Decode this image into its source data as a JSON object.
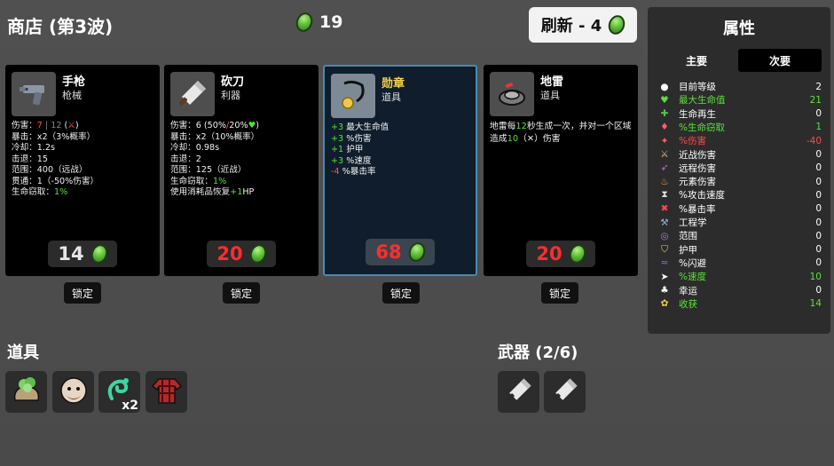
{
  "header": {
    "title": "商店 (第3波)",
    "materials": "19",
    "reroll_label": "刷新 - 4"
  },
  "shop": {
    "items": [
      {
        "name": "手枪",
        "category": "枪械",
        "price": "14",
        "price_color": "#e6e6e6",
        "lock_label": "锁定",
        "icon": "pistol-icon",
        "stats": [
          {
            "segments": [
              {
                "t": "伤害：",
                "c": ""
              },
              {
                "t": "7",
                "c": "r"
              },
              {
                "t": " | 12",
                "c": "gr"
              },
              {
                "t": " (",
                "c": ""
              },
              {
                "t": "⚔",
                "c": "r"
              },
              {
                "t": ")",
                "c": ""
              }
            ]
          },
          {
            "segments": [
              {
                "t": "暴击：x2（3%概率）",
                "c": ""
              }
            ]
          },
          {
            "segments": [
              {
                "t": "冷却：1.2s",
                "c": ""
              }
            ]
          },
          {
            "segments": [
              {
                "t": "击退：15",
                "c": ""
              }
            ]
          },
          {
            "segments": [
              {
                "t": "范围：400（远战）",
                "c": ""
              }
            ]
          },
          {
            "segments": [
              {
                "t": "贯通：1（-50%伤害）",
                "c": ""
              }
            ]
          },
          {
            "segments": [
              {
                "t": "生命窃取：",
                "c": ""
              },
              {
                "t": "1%",
                "c": "g"
              }
            ]
          }
        ]
      },
      {
        "name": "砍刀",
        "category": "利器",
        "price": "20",
        "price_color": "#ff2e2e",
        "lock_label": "锁定",
        "icon": "cleaver-icon",
        "stats": [
          {
            "segments": [
              {
                "t": "伤害：6 (50%",
                "c": ""
              },
              {
                "t": "/",
                "c": "r"
              },
              {
                "t": "20%",
                "c": ""
              },
              {
                "t": "♥",
                "c": "g"
              },
              {
                "t": ")",
                "c": ""
              }
            ]
          },
          {
            "segments": [
              {
                "t": "暴击：x2（10%概率）",
                "c": ""
              }
            ]
          },
          {
            "segments": [
              {
                "t": "冷却：0.98s",
                "c": ""
              }
            ]
          },
          {
            "segments": [
              {
                "t": "击退：2",
                "c": ""
              }
            ]
          },
          {
            "segments": [
              {
                "t": "范围：125（近战）",
                "c": ""
              }
            ]
          },
          {
            "segments": [
              {
                "t": "生命窃取：",
                "c": ""
              },
              {
                "t": "1%",
                "c": "g"
              }
            ]
          },
          {
            "segments": [
              {
                "t": "使用消耗品恢复",
                "c": ""
              },
              {
                "t": "+1",
                "c": "g"
              },
              {
                "t": "HP",
                "c": ""
              }
            ]
          }
        ]
      },
      {
        "name": "勋章",
        "category": "道具",
        "price": "68",
        "price_color": "#ff2e2e",
        "lock_label": "锁定",
        "icon": "medal-icon",
        "stats": [
          {
            "segments": [
              {
                "t": "+3",
                "c": "g"
              },
              {
                "t": " 最大生命值",
                "c": ""
              }
            ]
          },
          {
            "segments": [
              {
                "t": "+3",
                "c": "g"
              },
              {
                "t": " %伤害",
                "c": ""
              }
            ]
          },
          {
            "segments": [
              {
                "t": "+1",
                "c": "g"
              },
              {
                "t": " 护甲",
                "c": ""
              }
            ]
          },
          {
            "segments": [
              {
                "t": "+3",
                "c": "g"
              },
              {
                "t": " %速度",
                "c": ""
              }
            ]
          },
          {
            "segments": [
              {
                "t": "-4",
                "c": "r"
              },
              {
                "t": " %暴击率",
                "c": ""
              }
            ]
          }
        ]
      },
      {
        "name": "地雷",
        "category": "道具",
        "price": "20",
        "price_color": "#ff2e2e",
        "lock_label": "锁定",
        "icon": "landmine-icon",
        "stats": [
          {
            "segments": [
              {
                "t": "地雷每",
                "c": ""
              },
              {
                "t": "12",
                "c": "g"
              },
              {
                "t": "秒生成一次，并对一个区域",
                "c": ""
              }
            ]
          },
          {
            "segments": [
              {
                "t": "造成",
                "c": ""
              },
              {
                "t": "10",
                "c": "g"
              },
              {
                "t": "（",
                "c": ""
              },
              {
                "t": "✕",
                "c": ""
              },
              {
                "t": "）伤害",
                "c": ""
              }
            ]
          }
        ]
      }
    ]
  },
  "inventory": {
    "items_title": "道具",
    "items": [
      {
        "icon": "broccoli-bag-icon",
        "qty": ""
      },
      {
        "icon": "bearded-face-icon",
        "qty": ""
      },
      {
        "icon": "green-swirl-icon",
        "qty": "x2"
      },
      {
        "icon": "plaid-shirt-icon",
        "qty": ""
      }
    ],
    "weapons_title": "武器 (2/6)",
    "weapons": [
      {
        "icon": "cleaver-icon"
      },
      {
        "icon": "cleaver-icon"
      }
    ]
  },
  "stats_panel": {
    "title": "属性",
    "tabs": [
      {
        "label": "主要",
        "active": false
      },
      {
        "label": "次要",
        "active": true
      }
    ],
    "rows": [
      {
        "icon": "level-icon",
        "name": "目前等级",
        "value": "2",
        "color": "",
        "icon_color": "#ffffff"
      },
      {
        "icon": "heart-icon",
        "name": "最大生命值",
        "value": "21",
        "color": "g",
        "icon_color": "#5be03a"
      },
      {
        "icon": "regen-icon",
        "name": "生命再生",
        "value": "0",
        "color": "",
        "icon_color": "#55c24a"
      },
      {
        "icon": "lifesteal-icon",
        "name": "%生命窃取",
        "value": "1",
        "color": "g",
        "icon_color": "#ff6060"
      },
      {
        "icon": "damage-icon",
        "name": "%伤害",
        "value": "-40",
        "color": "r",
        "icon_color": "#ff6060"
      },
      {
        "icon": "melee-icon",
        "name": "近战伤害",
        "value": "0",
        "color": "",
        "icon_color": "#e8c17a"
      },
      {
        "icon": "ranged-icon",
        "name": "远程伤害",
        "value": "0",
        "color": "",
        "icon_color": "#c77ad9"
      },
      {
        "icon": "elemental-icon",
        "name": "元素伤害",
        "value": "0",
        "color": "",
        "icon_color": "#ff9a4a"
      },
      {
        "icon": "attack-speed-icon",
        "name": "%攻击速度",
        "value": "0",
        "color": "",
        "icon_color": "#e0e0e0"
      },
      {
        "icon": "crit-icon",
        "name": "%暴击率",
        "value": "0",
        "color": "",
        "icon_color": "#ff4a4a"
      },
      {
        "icon": "engineering-icon",
        "name": "工程学",
        "value": "0",
        "color": "",
        "icon_color": "#8ab4d8"
      },
      {
        "icon": "range-icon",
        "name": "范围",
        "value": "0",
        "color": "",
        "icon_color": "#b07ae0"
      },
      {
        "icon": "armor-icon",
        "name": "护甲",
        "value": "0",
        "color": "",
        "icon_color": "#f2d24a"
      },
      {
        "icon": "dodge-icon",
        "name": "%闪避",
        "value": "0",
        "color": "",
        "icon_color": "#a070d0"
      },
      {
        "icon": "speed-icon",
        "name": "%速度",
        "value": "10",
        "color": "g",
        "icon_color": "#ffffff"
      },
      {
        "icon": "luck-icon",
        "name": "幸运",
        "value": "0",
        "color": "",
        "icon_color": "#ffffff"
      },
      {
        "icon": "harvest-icon",
        "name": "收获",
        "value": "14",
        "color": "g",
        "icon_color": "#f2d24a"
      }
    ]
  }
}
